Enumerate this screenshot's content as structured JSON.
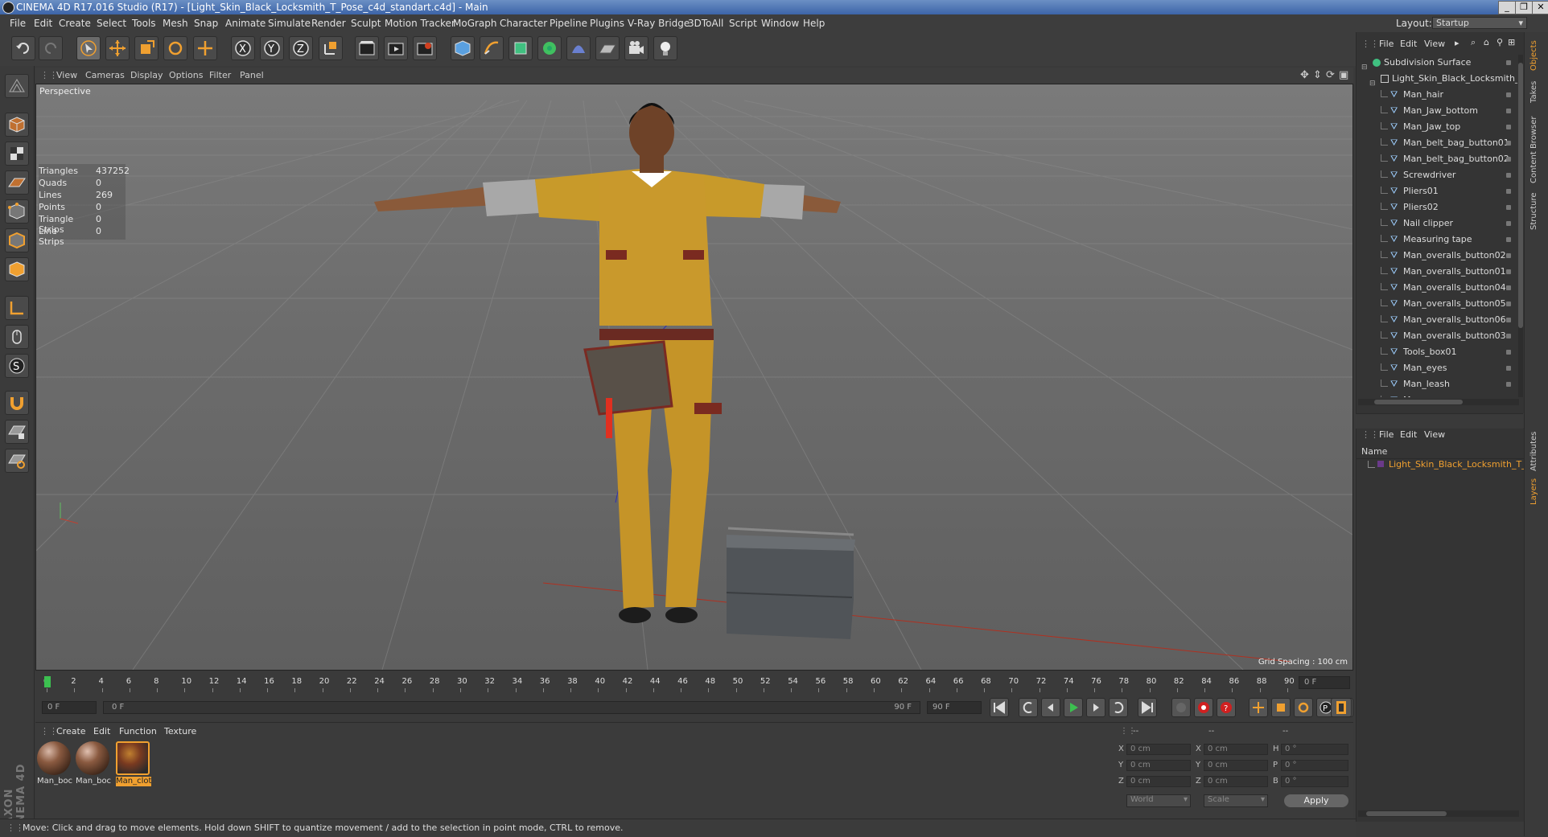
{
  "title_bar": {
    "title": "CINEMA 4D R17.016 Studio (R17) - [Light_Skin_Black_Locksmith_T_Pose_c4d_standart.c4d] - Main"
  },
  "menu": [
    "File",
    "Edit",
    "Create",
    "Select",
    "Tools",
    "Mesh",
    "Snap",
    "Animate",
    "Simulate",
    "Render",
    "Sculpt",
    "Motion Tracker",
    "MoGraph",
    "Character",
    "Pipeline",
    "Plugins",
    "V-Ray Bridge",
    "3DToAll",
    "Script",
    "Window",
    "Help"
  ],
  "layout": {
    "label": "Layout:",
    "value": "Startup"
  },
  "viewport": {
    "menu": [
      "View",
      "Cameras",
      "Display",
      "Options",
      "Filter",
      "Panel"
    ],
    "camera_label": "Perspective",
    "grid_spacing": "Grid Spacing : 100 cm",
    "stats": [
      {
        "k": "Triangles",
        "v": "437252"
      },
      {
        "k": "Quads",
        "v": "0"
      },
      {
        "k": "Lines",
        "v": "269"
      },
      {
        "k": "Points",
        "v": "0"
      },
      {
        "k": "Triangle Strips",
        "v": "0"
      },
      {
        "k": "Line Strips",
        "v": "0"
      }
    ]
  },
  "timeline": {
    "ticks": [
      "0",
      "2",
      "4",
      "6",
      "8",
      "10",
      "12",
      "14",
      "16",
      "18",
      "20",
      "22",
      "24",
      "26",
      "28",
      "30",
      "32",
      "34",
      "36",
      "38",
      "40",
      "42",
      "44",
      "46",
      "48",
      "50",
      "52",
      "54",
      "56",
      "58",
      "60",
      "62",
      "64",
      "66",
      "68",
      "70",
      "72",
      "74",
      "76",
      "78",
      "80",
      "82",
      "84",
      "86",
      "88",
      "90"
    ],
    "current_frame": "0 F",
    "start_field": "0 F",
    "range_start": "0 F",
    "range_end": "90 F",
    "end_field": "90 F"
  },
  "materials": {
    "menu": [
      "Create",
      "Edit",
      "Function",
      "Texture"
    ],
    "items": [
      "Man_boc",
      "Man_boc",
      "Man_clot"
    ]
  },
  "coords": {
    "headers": [
      "--",
      "--",
      "--"
    ],
    "rows": [
      {
        "a": "X",
        "av": "0 cm",
        "b": "X",
        "bv": "0 cm",
        "c": "H",
        "cv": "0 °"
      },
      {
        "a": "Y",
        "av": "0 cm",
        "b": "Y",
        "bv": "0 cm",
        "c": "P",
        "cv": "0 °"
      },
      {
        "a": "Z",
        "av": "0 cm",
        "b": "Z",
        "bv": "0 cm",
        "c": "B",
        "cv": "0 °"
      }
    ],
    "mode1": "World",
    "mode2": "Scale",
    "apply": "Apply"
  },
  "status": "Move: Click and drag to move elements. Hold down SHIFT to quantize movement / add to the selection in point mode, CTRL to remove.",
  "objects": {
    "menu": [
      "File",
      "Edit",
      "View"
    ],
    "root": "Subdivision Surface",
    "group": "Light_Skin_Black_Locksmith_T_P",
    "items": [
      "Man_hair",
      "Man_Jaw_bottom",
      "Man_Jaw_top",
      "Man_belt_bag_button01",
      "Man_belt_bag_button02",
      "Screwdriver",
      "Pliers01",
      "Pliers02",
      "Nail clipper",
      "Measuring tape",
      "Man_overalls_button02",
      "Man_overalls_button01",
      "Man_overalls_button04",
      "Man_overalls_button05",
      "Man_overalls_button06",
      "Man_overalls_button03",
      "Tools_box01",
      "Man_eyes",
      "Man_leash",
      "Man"
    ]
  },
  "layers": {
    "menu": [
      "File",
      "Edit",
      "View"
    ],
    "column": "Name",
    "item": "Light_Skin_Black_Locksmith_T_Pose"
  },
  "side_tabs": [
    "Objects",
    "Takes",
    "Content Browser",
    "Structure",
    "Attributes",
    "Layers"
  ],
  "brand": "MAXON CINEMA 4D",
  "colors": {
    "accent": "#f0a030",
    "selected_text": "#f0a030",
    "ui_bg": "#3b3b3b"
  }
}
